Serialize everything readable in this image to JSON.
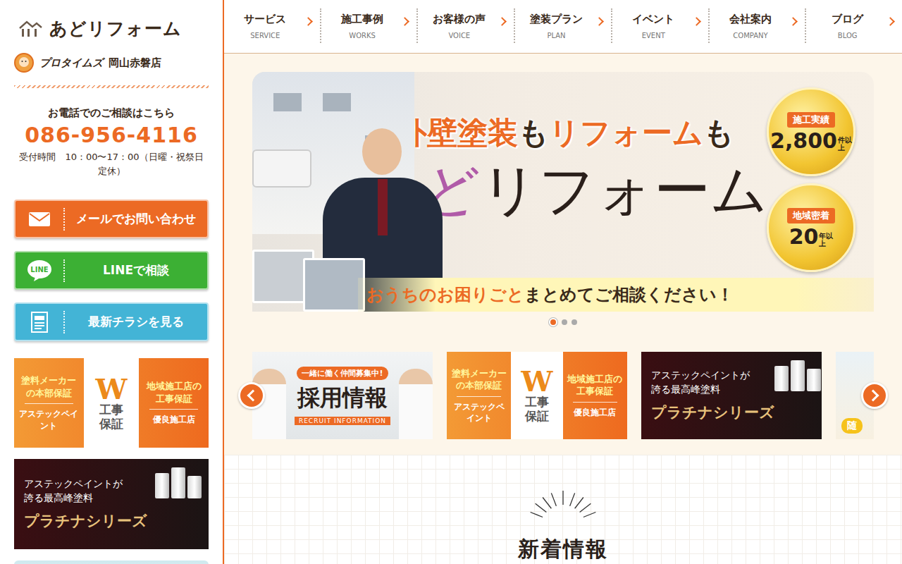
{
  "logo": {
    "name": "あどリフォーム",
    "store_brand": "プロタイムズ",
    "store_name": "岡山赤磐店"
  },
  "contact": {
    "lead": "お電話でのご相談はこちら",
    "phone": "086-956-4116",
    "hours": "受付時間　10：00〜17：00（日曜・祝祭日定休）"
  },
  "actions": [
    {
      "label": "メールでお問い合わせ",
      "kind": "mail",
      "icon_text": "",
      "color": "#ec6a24"
    },
    {
      "label": "LINEで相談",
      "kind": "line",
      "icon_text": "LINE",
      "color": "#3cb034"
    },
    {
      "label": "最新チラシを見る",
      "kind": "flyer",
      "icon_text": "",
      "color": "#43b4d6"
    }
  ],
  "side_banners": [
    {
      "kind": "warranty",
      "left_top": "塗料メーカーの本部保証",
      "left_bottom": "アステックペイント",
      "mark": "W",
      "center": "工事保証",
      "right_top": "地域施工店の工事保証",
      "right_bottom": "優良施工店"
    },
    {
      "kind": "platinum",
      "lead": "アステックペイントが誇る最高峰塗料",
      "title": "プラチナシリーズ"
    },
    {
      "kind": "blank"
    }
  ],
  "nav": [
    {
      "label": "サービス",
      "sub": "SERVICE"
    },
    {
      "label": "施工事例",
      "sub": "WORKS"
    },
    {
      "label": "お客様の声",
      "sub": "VOICE"
    },
    {
      "label": "塗装プラン",
      "sub": "PLAN"
    },
    {
      "label": "イベント",
      "sub": "EVENT"
    },
    {
      "label": "会社案内",
      "sub": "COMPANY"
    },
    {
      "label": "ブログ",
      "sub": "BLOG"
    }
  ],
  "hero": {
    "headline": [
      {
        "text": "外壁塗装",
        "accent": true
      },
      {
        "text": "も",
        "accent": false
      },
      {
        "text": "リフォーム",
        "accent": true
      },
      {
        "text": "も",
        "accent": false
      }
    ],
    "brand": [
      {
        "text": "あど",
        "accent": true
      },
      {
        "text": "リフォーム",
        "accent": false
      }
    ],
    "badges": [
      {
        "label": "施工実績",
        "value": "2,800",
        "unit": "件以上"
      },
      {
        "label": "地域密着",
        "value": "20",
        "unit": "年以上"
      }
    ],
    "tagline": [
      {
        "text": "おうちのお困りごと",
        "accent": true
      },
      {
        "text": "まとめてご相談ください！",
        "accent": false
      }
    ]
  },
  "slider_dots": [
    {
      "selected": true
    },
    {
      "selected": false
    },
    {
      "selected": false
    }
  ],
  "carousel": [
    {
      "kind": "recruit",
      "tag": "一緒に働く仲間募集中!",
      "title": "採用情報",
      "subtitle": "RECRUIT INFORMATION"
    },
    {
      "kind": "warranty",
      "left_top": "塗料メーカーの本部保証",
      "left_bottom": "アステックペイント",
      "mark": "W",
      "center": "工事保証",
      "right_top": "地域施工店の工事保証",
      "right_bottom": "優良施工店"
    },
    {
      "kind": "platinum",
      "lead": "アステックペイントが誇る最高峰塗料",
      "title": "プラチナシリーズ"
    },
    {
      "kind": "partial",
      "text": "随"
    }
  ],
  "news": {
    "title": "新着情報"
  }
}
